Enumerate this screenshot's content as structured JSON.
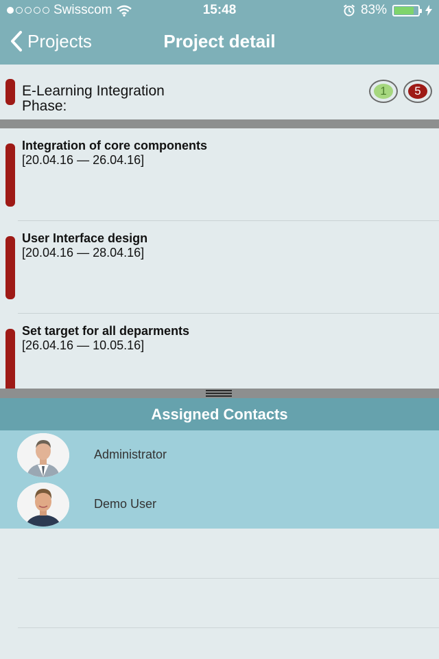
{
  "status_bar": {
    "carrier": "Swisscom",
    "signal_dots_filled": 1,
    "signal_dots_total": 5,
    "time": "15:48",
    "battery_percent": "83%",
    "battery_level": 0.83,
    "icons": [
      "wifi-icon",
      "alarm-icon",
      "battery-icon",
      "charging-icon"
    ]
  },
  "navbar": {
    "back_label": "Projects",
    "title": "Project detail"
  },
  "project": {
    "name": "E-Learning Integration",
    "phase_label": "Phase:",
    "badges": [
      {
        "value": "1",
        "color": "#a6d77f",
        "text_color": "#4d7f2f"
      },
      {
        "value": "5",
        "color": "#9e1a16",
        "text_color": "#ffffff"
      }
    ],
    "accent_color": "#9e1a16"
  },
  "tasks": [
    {
      "title": "Integration of core components",
      "dates": "[20.04.16 — 26.04.16]"
    },
    {
      "title": "User Interface design",
      "dates": "[20.04.16 — 28.04.16]"
    },
    {
      "title": "Set target for all deparments",
      "dates": "[26.04.16 — 10.05.16]"
    }
  ],
  "contacts": {
    "header": "Assigned Contacts",
    "items": [
      {
        "name": "Administrator",
        "avatar": "avatar-administrator"
      },
      {
        "name": "Demo User",
        "avatar": "avatar-demo-user"
      }
    ]
  },
  "colors": {
    "bar": "#7eb0b8",
    "contacts_header": "#66a2ad",
    "contacts_list": "#9ecfda",
    "background": "#e3ebed"
  }
}
